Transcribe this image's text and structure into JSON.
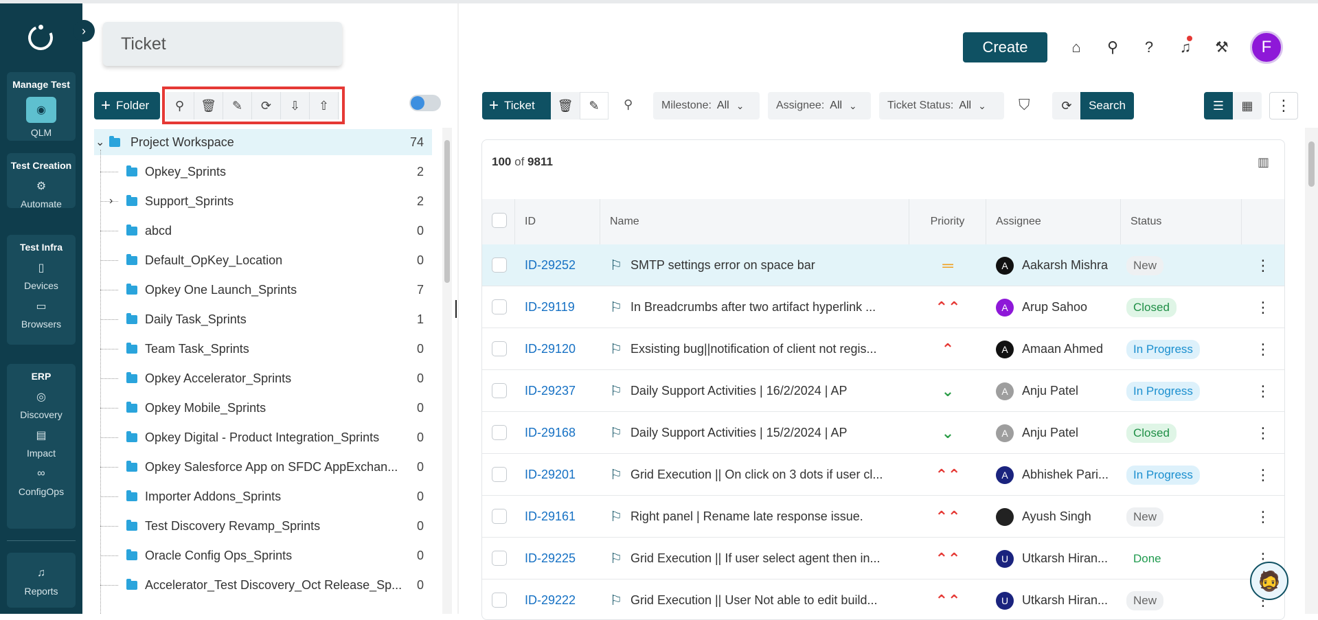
{
  "sidebar": {
    "groups": [
      {
        "title": "Manage Test",
        "items": [
          {
            "label": "QLM",
            "icon": "qlm-icon"
          }
        ]
      },
      {
        "title": "Test Creation",
        "items": [
          {
            "label": "Automate",
            "icon": "automate-gear-icon"
          }
        ]
      },
      {
        "title": "Test Infra",
        "items": [
          {
            "label": "Devices",
            "icon": "device-icon"
          },
          {
            "label": "Browsers",
            "icon": "monitor-icon"
          }
        ]
      },
      {
        "title": "ERP",
        "items": [
          {
            "label": "Discovery",
            "icon": "compass-icon"
          },
          {
            "label": "Impact",
            "icon": "impact-icon"
          },
          {
            "label": "ConfigOps",
            "icon": "link-icon"
          }
        ]
      }
    ],
    "bottom": {
      "label": "Reports",
      "icon": "reports-icon"
    }
  },
  "left_panel": {
    "title": "Ticket",
    "folder_button": "Folder",
    "tree": {
      "root": {
        "name": "Project Workspace",
        "count": "74"
      },
      "children": [
        {
          "name": "Opkey_Sprints",
          "count": "2"
        },
        {
          "name": "Support_Sprints",
          "count": "2"
        },
        {
          "name": "abcd",
          "count": "0"
        },
        {
          "name": "Default_OpKey_Location",
          "count": "0"
        },
        {
          "name": "Opkey One Launch_Sprints",
          "count": "7"
        },
        {
          "name": "Daily Task_Sprints",
          "count": "1"
        },
        {
          "name": "Team Task_Sprints",
          "count": "0"
        },
        {
          "name": "Opkey Accelerator_Sprints",
          "count": "0"
        },
        {
          "name": "Opkey Mobile_Sprints",
          "count": "0"
        },
        {
          "name": "Opkey Digital - Product Integration_Sprints",
          "count": "0"
        },
        {
          "name": "Opkey Salesforce App on SFDC AppExchan...",
          "count": "0"
        },
        {
          "name": "Importer Addons_Sprints",
          "count": "0"
        },
        {
          "name": "Test Discovery Revamp_Sprints",
          "count": "0"
        },
        {
          "name": "Oracle Config Ops_Sprints",
          "count": "0"
        },
        {
          "name": "Accelerator_Test Discovery_Oct Release_Sp...",
          "count": "0"
        }
      ]
    }
  },
  "header": {
    "create_label": "Create",
    "avatar_letter": "F"
  },
  "toolbar": {
    "ticket_button": "Ticket",
    "filters": [
      {
        "label": "Milestone:",
        "value": "All"
      },
      {
        "label": "Assignee:",
        "value": "All"
      },
      {
        "label": "Ticket Status:",
        "value": "All"
      }
    ],
    "search_button": "Search"
  },
  "table": {
    "count_shown": "100",
    "count_of": "of",
    "count_total": "9811",
    "columns": [
      "ID",
      "Name",
      "Priority",
      "Assignee",
      "Status"
    ],
    "rows": [
      {
        "id": "ID-29252",
        "name": "SMTP settings error on space bar",
        "priority": "medium",
        "assignee": "Aakarsh Mishra",
        "avatar": "A",
        "avatar_color": "#111111",
        "status": "New"
      },
      {
        "id": "ID-29119",
        "name": "In Breadcrumbs after two artifact hyperlink ...",
        "priority": "highest",
        "assignee": "Arup Sahoo",
        "avatar": "A",
        "avatar_color": "#8e18d8",
        "status": "Closed"
      },
      {
        "id": "ID-29120",
        "name": "Exsisting bug||notification of client not regis...",
        "priority": "high",
        "assignee": "Amaan Ahmed",
        "avatar": "A",
        "avatar_color": "#111111",
        "status": "In Progress"
      },
      {
        "id": "ID-29237",
        "name": "Daily Support Activities | 16/2/2024 | AP",
        "priority": "low",
        "assignee": "Anju Patel",
        "avatar": "A",
        "avatar_color": "#9e9e9e",
        "status": "In Progress"
      },
      {
        "id": "ID-29168",
        "name": "Daily Support Activities | 15/2/2024 | AP",
        "priority": "low",
        "assignee": "Anju Patel",
        "avatar": "A",
        "avatar_color": "#9e9e9e",
        "status": "Closed"
      },
      {
        "id": "ID-29201",
        "name": "Grid Execution || On click on 3 dots if user cl...",
        "priority": "highest",
        "assignee": "Abhishek Pari...",
        "avatar": "A",
        "avatar_color": "#1a237e",
        "status": "In Progress"
      },
      {
        "id": "ID-29161",
        "name": "Right panel | Rename late response issue.",
        "priority": "highest",
        "assignee": "Ayush Singh",
        "avatar": "",
        "avatar_color": "#222222",
        "status": "New"
      },
      {
        "id": "ID-29225",
        "name": "Grid Execution || If user select agent then in...",
        "priority": "highest",
        "assignee": "Utkarsh Hiran...",
        "avatar": "U",
        "avatar_color": "#1a237e",
        "status": "Done"
      },
      {
        "id": "ID-29222",
        "name": "Grid Execution || User Not able to edit build...",
        "priority": "highest",
        "assignee": "Utkarsh Hiran...",
        "avatar": "U",
        "avatar_color": "#1a237e",
        "status": "New"
      }
    ]
  }
}
